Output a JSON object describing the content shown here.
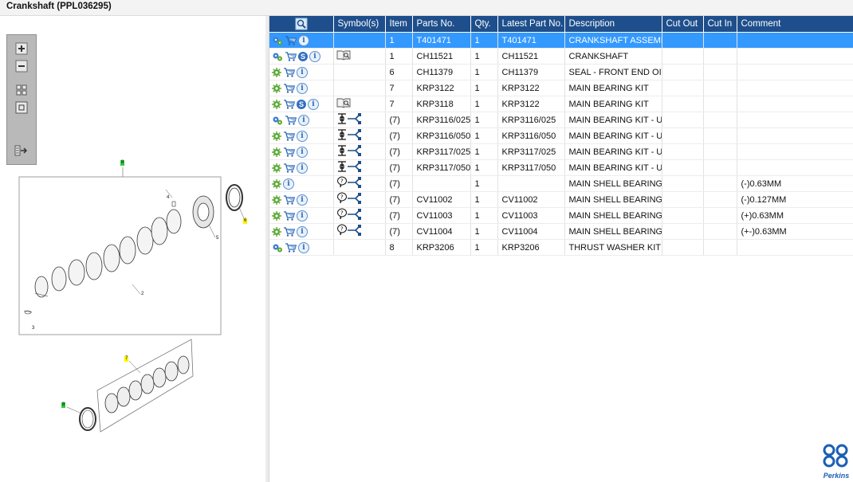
{
  "window": {
    "title": "Crankshaft (PPL036295)"
  },
  "zoom_toolbar": {
    "zoom_in": "zoom-in",
    "zoom_out": "zoom-out",
    "fit": "fit",
    "actual": "actual",
    "export": "export"
  },
  "illustration": {
    "callouts": [
      {
        "id": "c8a",
        "label": "8",
        "color": "#2ecc40"
      },
      {
        "id": "c4",
        "label": "4",
        "color": ""
      },
      {
        "id": "c5",
        "label": "5",
        "color": ""
      },
      {
        "id": "c6",
        "label": "6",
        "color": "#fff200"
      },
      {
        "id": "c2",
        "label": "2",
        "color": ""
      },
      {
        "id": "c3",
        "label": "3",
        "color": ""
      },
      {
        "id": "c7",
        "label": "7",
        "color": "#fff200"
      },
      {
        "id": "c8b",
        "label": "8",
        "color": "#2ecc40"
      }
    ]
  },
  "table": {
    "headers": {
      "icons": "",
      "symbols": "Symbol(s)",
      "item": "Item",
      "part_no": "Parts No.",
      "qty": "Qty.",
      "latest": "Latest Part No.",
      "description": "Description",
      "cut_out": "Cut Out",
      "cut_in": "Cut In",
      "comment": "Comment"
    },
    "rows": [
      {
        "item": "1",
        "part_no": "T401471",
        "qty": "1",
        "latest": "T401471",
        "description": "CRANKSHAFT ASSEMBLY",
        "cut_out": "",
        "cut_in": "",
        "comment": "",
        "selected": true,
        "icons": [
          "gear-blue",
          "cart",
          "info"
        ],
        "symbol": ""
      },
      {
        "item": "1",
        "part_no": "CH11521",
        "qty": "1",
        "latest": "CH11521",
        "description": "CRANKSHAFT",
        "cut_out": "",
        "cut_in": "",
        "comment": "",
        "icons": [
          "gear-blue",
          "cart",
          "s",
          "info"
        ],
        "symbol": "book"
      },
      {
        "item": "6",
        "part_no": "CH11379",
        "qty": "1",
        "latest": "CH11379",
        "description": "SEAL - FRONT END OIL",
        "cut_out": "",
        "cut_in": "",
        "comment": "",
        "icons": [
          "gear",
          "cart",
          "info"
        ],
        "symbol": ""
      },
      {
        "item": "7",
        "part_no": "KRP3122",
        "qty": "1",
        "latest": "KRP3122",
        "description": "MAIN BEARING KIT",
        "cut_out": "",
        "cut_in": "",
        "comment": "",
        "icons": [
          "gear",
          "cart",
          "info"
        ],
        "symbol": ""
      },
      {
        "item": "7",
        "part_no": "KRP3118",
        "qty": "1",
        "latest": "KRP3122",
        "description": "MAIN BEARING KIT",
        "cut_out": "",
        "cut_in": "",
        "comment": "",
        "icons": [
          "gear",
          "cart",
          "s",
          "info"
        ],
        "symbol": "book"
      },
      {
        "item": "(7)",
        "part_no": "KRP3116/025",
        "qty": "1",
        "latest": "KRP3116/025",
        "description": "MAIN BEARING KIT - U/S",
        "cut_out": "",
        "cut_in": "",
        "comment": "",
        "icons": [
          "gear-blue",
          "cart",
          "info"
        ],
        "symbol": "split"
      },
      {
        "item": "(7)",
        "part_no": "KRP3116/050",
        "qty": "1",
        "latest": "KRP3116/050",
        "description": "MAIN BEARING KIT - U/S",
        "cut_out": "",
        "cut_in": "",
        "comment": "",
        "icons": [
          "gear",
          "cart",
          "info"
        ],
        "symbol": "split"
      },
      {
        "item": "(7)",
        "part_no": "KRP3117/025",
        "qty": "1",
        "latest": "KRP3117/025",
        "description": "MAIN BEARING KIT - U/S",
        "cut_out": "",
        "cut_in": "",
        "comment": "",
        "icons": [
          "gear",
          "cart",
          "info"
        ],
        "symbol": "split"
      },
      {
        "item": "(7)",
        "part_no": "KRP3117/050",
        "qty": "1",
        "latest": "KRP3117/050",
        "description": "MAIN BEARING KIT - U/S",
        "cut_out": "",
        "cut_in": "",
        "comment": "",
        "icons": [
          "gear",
          "cart",
          "info"
        ],
        "symbol": "split"
      },
      {
        "item": "(7)",
        "part_no": "",
        "qty": "1",
        "latest": "",
        "description": "MAIN SHELL BEARING",
        "cut_out": "",
        "cut_in": "",
        "comment": "(-)0.63MM",
        "icons": [
          "gear",
          "info"
        ],
        "symbol": "balloon"
      },
      {
        "item": "(7)",
        "part_no": "CV11002",
        "qty": "1",
        "latest": "CV11002",
        "description": "MAIN SHELL BEARING",
        "cut_out": "",
        "cut_in": "",
        "comment": "(-)0.127MM",
        "icons": [
          "gear",
          "cart",
          "info"
        ],
        "symbol": "balloon"
      },
      {
        "item": "(7)",
        "part_no": "CV11003",
        "qty": "1",
        "latest": "CV11003",
        "description": "MAIN SHELL BEARING",
        "cut_out": "",
        "cut_in": "",
        "comment": "(+)0.63MM",
        "icons": [
          "gear",
          "cart",
          "info"
        ],
        "symbol": "balloon"
      },
      {
        "item": "(7)",
        "part_no": "CV11004",
        "qty": "1",
        "latest": "CV11004",
        "description": "MAIN SHELL BEARING",
        "cut_out": "",
        "cut_in": "",
        "comment": "(+-)0.63MM",
        "icons": [
          "gear",
          "cart",
          "info"
        ],
        "symbol": "balloon"
      },
      {
        "item": "8",
        "part_no": "KRP3206",
        "qty": "1",
        "latest": "KRP3206",
        "description": "THRUST WASHER KIT",
        "cut_out": "",
        "cut_in": "",
        "comment": "",
        "icons": [
          "gear-blue",
          "cart",
          "info"
        ],
        "symbol": ""
      }
    ]
  },
  "brand": {
    "name": "Perkins",
    "color": "#1a5fb4"
  },
  "colors": {
    "header_bg": "#1e4f8c",
    "selected_row": "#3399ff",
    "accent_green": "#4caf50"
  }
}
